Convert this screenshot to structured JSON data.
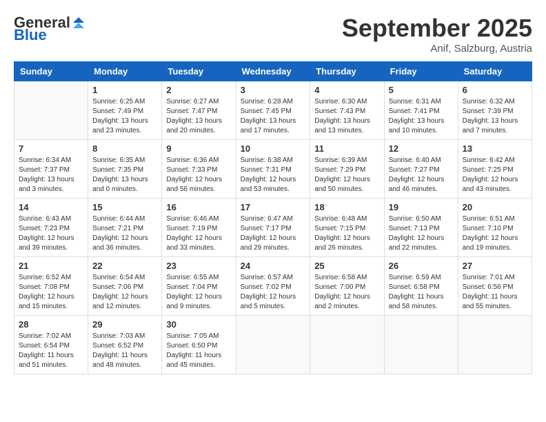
{
  "logo": {
    "general": "General",
    "blue": "Blue"
  },
  "header": {
    "month": "September 2025",
    "location": "Anif, Salzburg, Austria"
  },
  "weekdays": [
    "Sunday",
    "Monday",
    "Tuesday",
    "Wednesday",
    "Thursday",
    "Friday",
    "Saturday"
  ],
  "weeks": [
    [
      {
        "day": "",
        "info": ""
      },
      {
        "day": "1",
        "info": "Sunrise: 6:25 AM\nSunset: 7:49 PM\nDaylight: 13 hours\nand 23 minutes."
      },
      {
        "day": "2",
        "info": "Sunrise: 6:27 AM\nSunset: 7:47 PM\nDaylight: 13 hours\nand 20 minutes."
      },
      {
        "day": "3",
        "info": "Sunrise: 6:28 AM\nSunset: 7:45 PM\nDaylight: 13 hours\nand 17 minutes."
      },
      {
        "day": "4",
        "info": "Sunrise: 6:30 AM\nSunset: 7:43 PM\nDaylight: 13 hours\nand 13 minutes."
      },
      {
        "day": "5",
        "info": "Sunrise: 6:31 AM\nSunset: 7:41 PM\nDaylight: 13 hours\nand 10 minutes."
      },
      {
        "day": "6",
        "info": "Sunrise: 6:32 AM\nSunset: 7:39 PM\nDaylight: 13 hours\nand 7 minutes."
      }
    ],
    [
      {
        "day": "7",
        "info": "Sunrise: 6:34 AM\nSunset: 7:37 PM\nDaylight: 13 hours\nand 3 minutes."
      },
      {
        "day": "8",
        "info": "Sunrise: 6:35 AM\nSunset: 7:35 PM\nDaylight: 13 hours\nand 0 minutes."
      },
      {
        "day": "9",
        "info": "Sunrise: 6:36 AM\nSunset: 7:33 PM\nDaylight: 12 hours\nand 56 minutes."
      },
      {
        "day": "10",
        "info": "Sunrise: 6:38 AM\nSunset: 7:31 PM\nDaylight: 12 hours\nand 53 minutes."
      },
      {
        "day": "11",
        "info": "Sunrise: 6:39 AM\nSunset: 7:29 PM\nDaylight: 12 hours\nand 50 minutes."
      },
      {
        "day": "12",
        "info": "Sunrise: 6:40 AM\nSunset: 7:27 PM\nDaylight: 12 hours\nand 46 minutes."
      },
      {
        "day": "13",
        "info": "Sunrise: 6:42 AM\nSunset: 7:25 PM\nDaylight: 12 hours\nand 43 minutes."
      }
    ],
    [
      {
        "day": "14",
        "info": "Sunrise: 6:43 AM\nSunset: 7:23 PM\nDaylight: 12 hours\nand 39 minutes."
      },
      {
        "day": "15",
        "info": "Sunrise: 6:44 AM\nSunset: 7:21 PM\nDaylight: 12 hours\nand 36 minutes."
      },
      {
        "day": "16",
        "info": "Sunrise: 6:46 AM\nSunset: 7:19 PM\nDaylight: 12 hours\nand 33 minutes."
      },
      {
        "day": "17",
        "info": "Sunrise: 6:47 AM\nSunset: 7:17 PM\nDaylight: 12 hours\nand 29 minutes."
      },
      {
        "day": "18",
        "info": "Sunrise: 6:48 AM\nSunset: 7:15 PM\nDaylight: 12 hours\nand 26 minutes."
      },
      {
        "day": "19",
        "info": "Sunrise: 6:50 AM\nSunset: 7:13 PM\nDaylight: 12 hours\nand 22 minutes."
      },
      {
        "day": "20",
        "info": "Sunrise: 6:51 AM\nSunset: 7:10 PM\nDaylight: 12 hours\nand 19 minutes."
      }
    ],
    [
      {
        "day": "21",
        "info": "Sunrise: 6:52 AM\nSunset: 7:08 PM\nDaylight: 12 hours\nand 15 minutes."
      },
      {
        "day": "22",
        "info": "Sunrise: 6:54 AM\nSunset: 7:06 PM\nDaylight: 12 hours\nand 12 minutes."
      },
      {
        "day": "23",
        "info": "Sunrise: 6:55 AM\nSunset: 7:04 PM\nDaylight: 12 hours\nand 9 minutes."
      },
      {
        "day": "24",
        "info": "Sunrise: 6:57 AM\nSunset: 7:02 PM\nDaylight: 12 hours\nand 5 minutes."
      },
      {
        "day": "25",
        "info": "Sunrise: 6:58 AM\nSunset: 7:00 PM\nDaylight: 12 hours\nand 2 minutes."
      },
      {
        "day": "26",
        "info": "Sunrise: 6:59 AM\nSunset: 6:58 PM\nDaylight: 11 hours\nand 58 minutes."
      },
      {
        "day": "27",
        "info": "Sunrise: 7:01 AM\nSunset: 6:56 PM\nDaylight: 11 hours\nand 55 minutes."
      }
    ],
    [
      {
        "day": "28",
        "info": "Sunrise: 7:02 AM\nSunset: 6:54 PM\nDaylight: 11 hours\nand 51 minutes."
      },
      {
        "day": "29",
        "info": "Sunrise: 7:03 AM\nSunset: 6:52 PM\nDaylight: 11 hours\nand 48 minutes."
      },
      {
        "day": "30",
        "info": "Sunrise: 7:05 AM\nSunset: 6:50 PM\nDaylight: 11 hours\nand 45 minutes."
      },
      {
        "day": "",
        "info": ""
      },
      {
        "day": "",
        "info": ""
      },
      {
        "day": "",
        "info": ""
      },
      {
        "day": "",
        "info": ""
      }
    ]
  ]
}
